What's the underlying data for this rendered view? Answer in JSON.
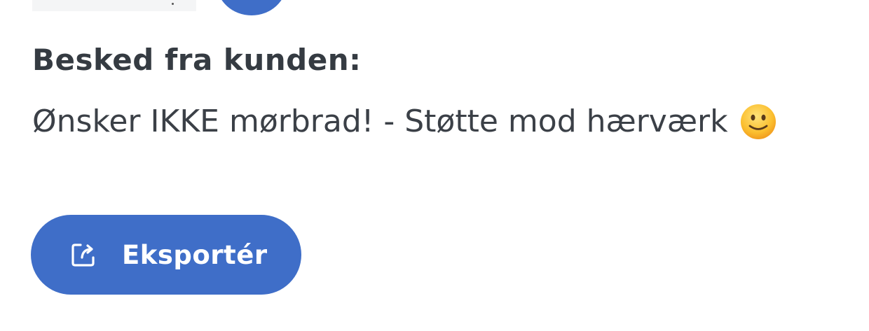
{
  "message": {
    "heading": "Besked fra kunden:",
    "body": "Ønsker IKKE mørbrad! - Støtte mod hærværk",
    "emoji_icon": "slightly-smiling-face-icon"
  },
  "actions": {
    "export_label": "Eksportér",
    "export_icon": "share-export-icon"
  },
  "colors": {
    "accent": "#3f6ec8",
    "text_dark": "#353b42",
    "background": "#ffffff"
  }
}
